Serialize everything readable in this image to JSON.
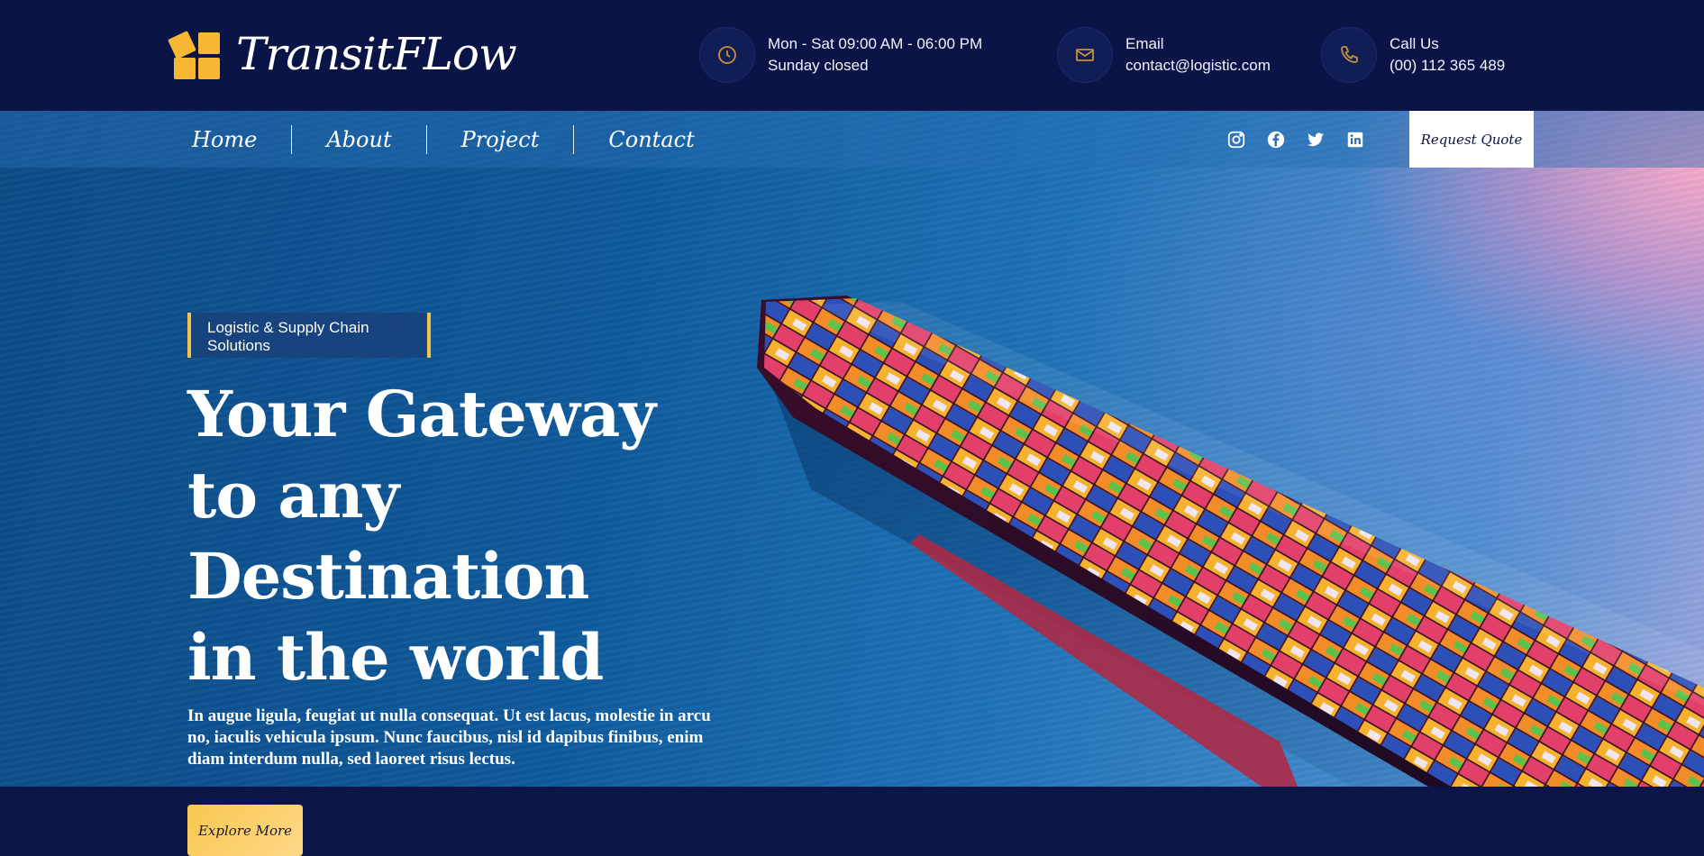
{
  "brand": {
    "name": "TransitFLow"
  },
  "contact": {
    "hours": {
      "icon": "clock-icon",
      "line1": "Mon - Sat 09:00 AM - 06:00 PM",
      "line2": "Sunday closed"
    },
    "email": {
      "icon": "mail-icon",
      "line1": "Email",
      "line2": "contact@logistic.com"
    },
    "phone": {
      "icon": "phone-icon",
      "line1": "Call Us",
      "line2": "(00) 112 365 489"
    }
  },
  "nav": {
    "items": [
      {
        "label": "Home"
      },
      {
        "label": "About"
      },
      {
        "label": "Project"
      },
      {
        "label": "Contact"
      }
    ],
    "socials": [
      "instagram-icon",
      "facebook-icon",
      "twitter-icon",
      "linkedin-icon"
    ],
    "cta_label": "Request Quote"
  },
  "hero": {
    "tag": "Logistic & Supply Chain Solutions",
    "headline_1": "Your Gateway",
    "headline_2": "to any Destination",
    "headline_3": "in the world",
    "body": "In augue ligula, feugiat ut nulla consequat. Ut est lacus, molestie in arcu no, iaculis vehicula ipsum. Nunc faucibus, nisl id dapibus finibus, enim diam interdum nulla, sed laoreet risus lectus.",
    "button_label": "Explore More"
  },
  "colors": {
    "navy": "#0a1446",
    "accent": "#f7b733",
    "white": "#ffffff"
  }
}
